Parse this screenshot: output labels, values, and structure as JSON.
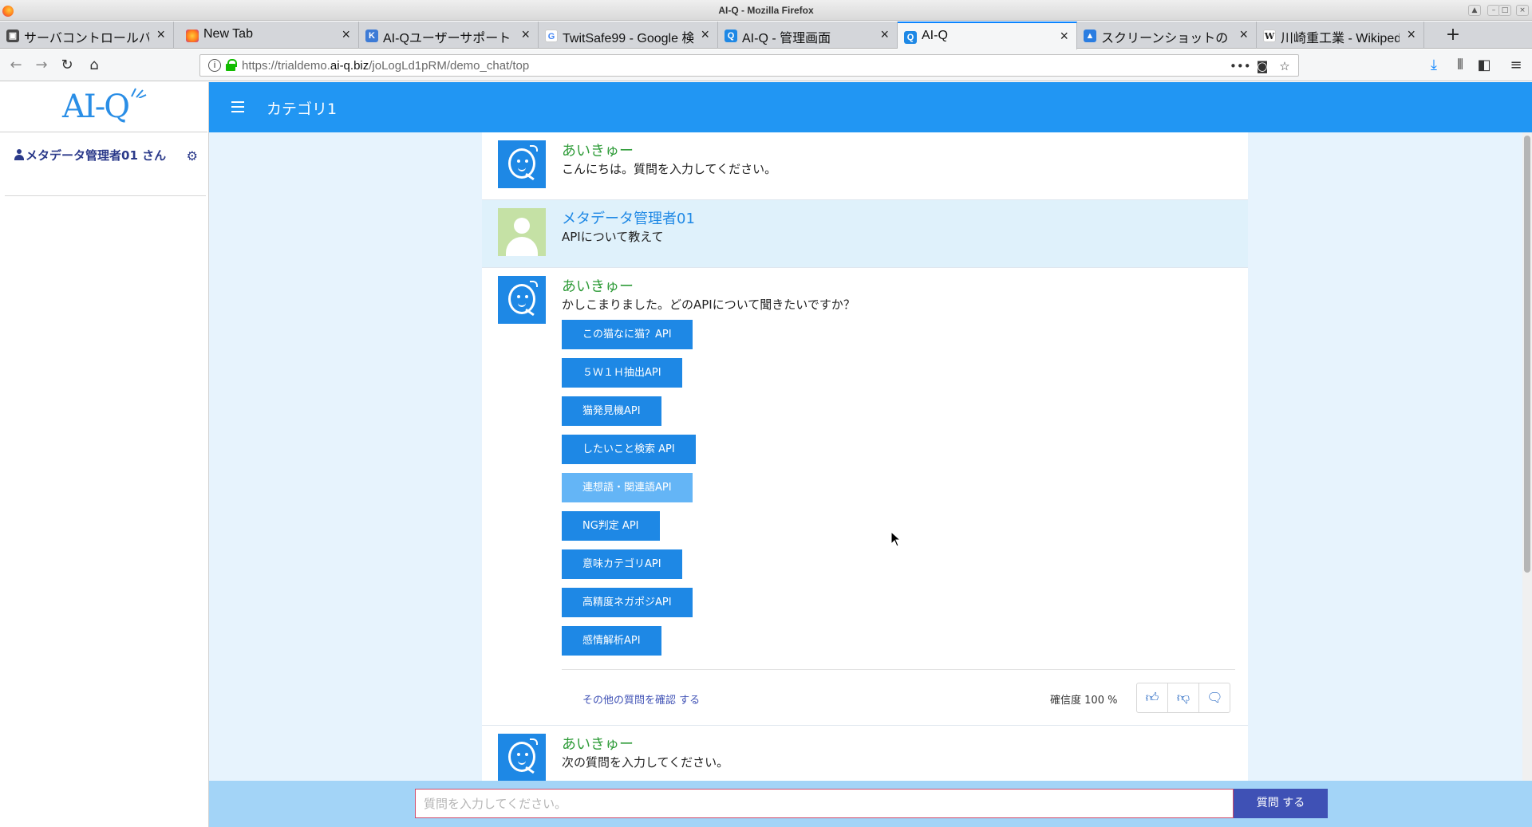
{
  "window": {
    "title": "AI-Q - Mozilla Firefox"
  },
  "tabs": [
    {
      "label": "サーバコントロールパ",
      "favicon": "server-panel-icon",
      "color": "#4a4a4a",
      "glyph": "▣"
    },
    {
      "label": "New Tab",
      "favicon": "firefox-icon",
      "color": "#ff7a1a",
      "glyph": "●"
    },
    {
      "label": "AI-Qユーザーサポート・",
      "favicon": "k-icon",
      "color": "#3d7bd6",
      "glyph": "K"
    },
    {
      "label": "TwitSafe99 - Google 検",
      "favicon": "google-icon",
      "color": "#4285f4",
      "glyph": "G"
    },
    {
      "label": "AI-Q - 管理画面",
      "favicon": "aiq-icon",
      "color": "#1e88e5",
      "glyph": "Q"
    },
    {
      "label": "AI-Q",
      "favicon": "aiq-icon",
      "color": "#1e88e5",
      "glyph": "Q"
    },
    {
      "label": "スクリーンショットの",
      "favicon": "screenshot-icon",
      "color": "#2a7de1",
      "glyph": "▲"
    },
    {
      "label": "川崎重工業 - Wikipedia",
      "favicon": "wikipedia-icon",
      "color": "#222222",
      "glyph": "W"
    }
  ],
  "url": {
    "prefix": "https://trialdemo.",
    "host": "ai-q.biz",
    "path": "/joLogLd1pRM/demo_chat/top"
  },
  "sidebar": {
    "logo": "AI-Q",
    "user": "メタデータ管理者01 さん"
  },
  "header": {
    "category": "カテゴリ1"
  },
  "chat": {
    "bot_name": "あいきゅー",
    "greeting": "こんにちは。質問を入力してください。",
    "user_name": "メタデータ管理者01",
    "user_message": "APIについて教えて",
    "reply": "かしこまりました。どのAPIについて聞きたいですか？",
    "options": [
      "この猫なに猫？API",
      "５Ｗ１Ｈ抽出API",
      "猫発見機API",
      "したいこと検索 API",
      "連想語・関連語API",
      "NG判定 API",
      "意味カテゴリAPI",
      "高精度ネガポジAPI",
      "感情解析API"
    ],
    "more_link": "その他の質問を確認 する",
    "confidence_label": "確信度",
    "confidence_value": "100 %",
    "next_prompt": "次の質問を入力してください。"
  },
  "input": {
    "placeholder": "質問を入力してください。",
    "submit": "質問 する"
  },
  "colors": {
    "accent": "#2196f3",
    "bot_name": "#2e9b38",
    "submit": "#3f51b5"
  }
}
